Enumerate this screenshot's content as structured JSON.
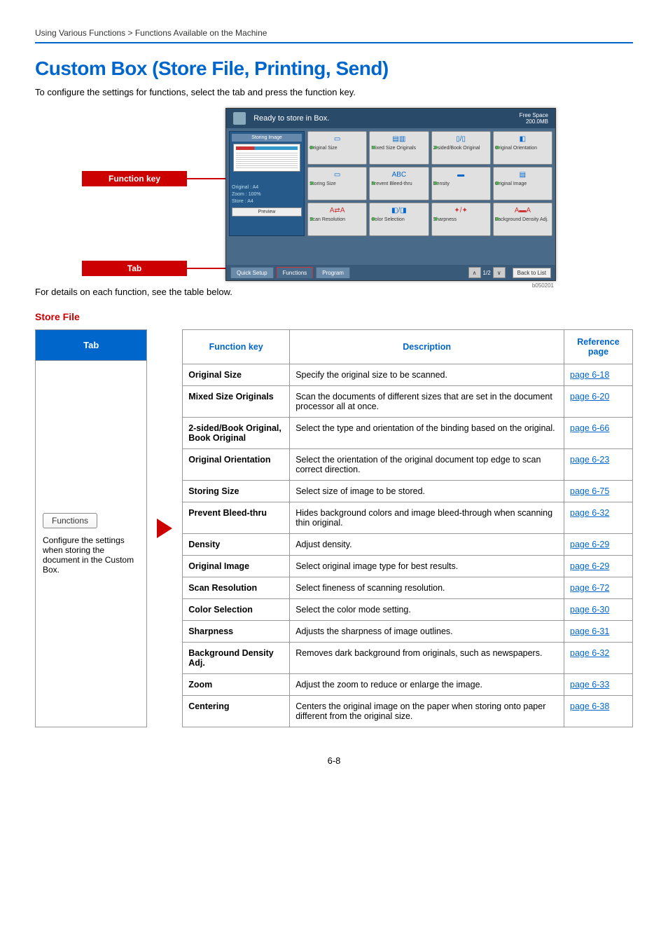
{
  "breadcrumb": "Using Various Functions > Functions Available on the Machine",
  "title": "Custom Box (Store File, Printing, Send)",
  "intro": "To configure the settings for functions, select the tab and press the function key.",
  "callouts": {
    "function_key": "Function key",
    "tab": "Tab"
  },
  "screenshot": {
    "header_text": "Ready to store in Box.",
    "free_space_label": "Free Space",
    "free_space_value": "200.0MB",
    "left_panel": {
      "section": "Storing Image",
      "meta": {
        "original_label": "Original",
        "original_value": ": A4",
        "zoom_label": "Zoom",
        "zoom_value": ": 100%",
        "store_label": "Store",
        "store_value": ": A4"
      },
      "preview": "Preview"
    },
    "buttons": [
      "Original Size",
      "Mixed Size Originals",
      "2-sided/Book Original",
      "Original Orientation",
      "Storing Size",
      "Prevent Bleed-thru",
      "Density",
      "Original Image",
      "Scan Resolution",
      "Color Selection",
      "Sharpness",
      "Background Density Adj."
    ],
    "tabs": {
      "quick": "Quick Setup",
      "functions": "Functions",
      "program": "Program"
    },
    "pager": "1/2",
    "back": "Back to List",
    "id": "b050201"
  },
  "for_details": "For details on each function, see the table below.",
  "section_heading": "Store File",
  "table_headers": {
    "tab": "Tab",
    "fn": "Function key",
    "desc": "Description",
    "ref": "Reference page"
  },
  "tab_cell": {
    "pill": "Functions",
    "note": "Configure the settings when storing the document in the Custom Box."
  },
  "rows": [
    {
      "fn": "Original Size",
      "desc": "Specify the original size to be scanned.",
      "ref": "page 6-18"
    },
    {
      "fn": "Mixed Size Originals",
      "desc": "Scan the documents of different sizes that are set in the document processor all at once.",
      "ref": "page 6-20"
    },
    {
      "fn": "2-sided/Book Original, Book Original",
      "desc": "Select the type and orientation of the binding based on the original.",
      "ref": "page 6-66"
    },
    {
      "fn": "Original Orientation",
      "desc": "Select the orientation of the original document top edge to scan correct direction.",
      "ref": "page 6-23"
    },
    {
      "fn": "Storing Size",
      "desc": "Select size of image to be stored.",
      "ref": "page 6-75"
    },
    {
      "fn": "Prevent Bleed-thru",
      "desc": "Hides background colors and image bleed-through when scanning thin original.",
      "ref": "page 6-32"
    },
    {
      "fn": "Density",
      "desc": "Adjust density.",
      "ref": "page 6-29"
    },
    {
      "fn": "Original Image",
      "desc": "Select original image type for best results.",
      "ref": "page 6-29"
    },
    {
      "fn": "Scan Resolution",
      "desc": "Select fineness of scanning resolution.",
      "ref": "page 6-72"
    },
    {
      "fn": "Color Selection",
      "desc": "Select the color mode setting.",
      "ref": "page 6-30"
    },
    {
      "fn": "Sharpness",
      "desc": "Adjusts the sharpness of image outlines.",
      "ref": "page 6-31"
    },
    {
      "fn": "Background Density Adj.",
      "desc": "Removes dark background from originals, such as newspapers.",
      "ref": "page 6-32"
    },
    {
      "fn": "Zoom",
      "desc": "Adjust the zoom to reduce or enlarge the image.",
      "ref": "page 6-33"
    },
    {
      "fn": "Centering",
      "desc": "Centers the original image on the paper when storing onto paper different from the original size.",
      "ref": "page 6-38"
    }
  ],
  "page_number": "6-8"
}
